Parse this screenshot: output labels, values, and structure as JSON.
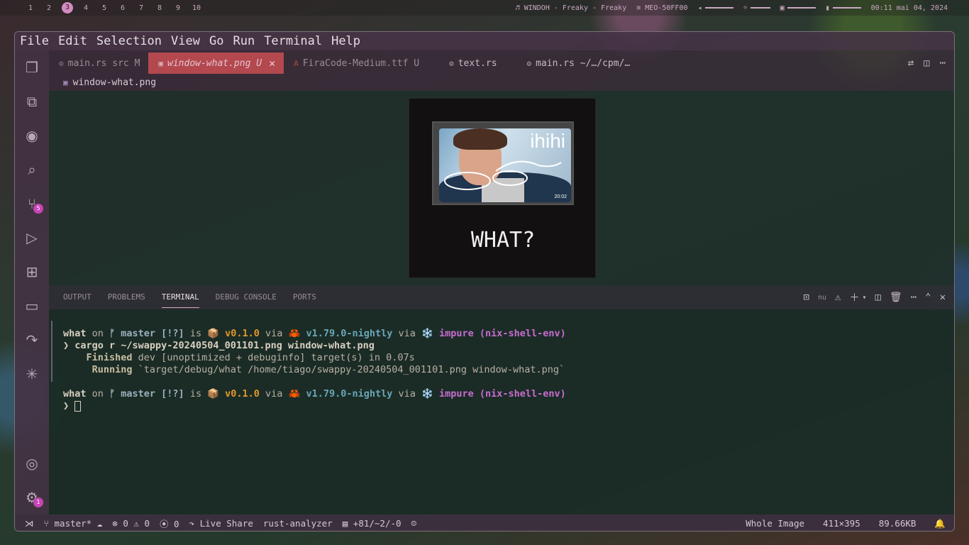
{
  "topbar": {
    "workspaces": [
      "1",
      "2",
      "3",
      "4",
      "5",
      "6",
      "7",
      "8",
      "9",
      "10"
    ],
    "active_workspace": "3",
    "now_playing": "♬ WINDOH - Freaky - Freaky",
    "wifi": "MEO-50FF00",
    "clock": "00:11 mai 04, 2024"
  },
  "menu": [
    "File",
    "Edit",
    "Selection",
    "View",
    "Go",
    "Run",
    "Terminal",
    "Help"
  ],
  "activity": {
    "source_control_badge": "5",
    "settings_badge": "1"
  },
  "tabs": [
    {
      "label": "main.rs",
      "detail": "src",
      "status": "M"
    },
    {
      "label": "window-what.png",
      "status": "U"
    },
    {
      "label": "FiraCode-Medium.ttf",
      "status": "U"
    },
    {
      "label": "text.rs"
    },
    {
      "label": "main.rs",
      "detail": "~/…/cpm/…"
    }
  ],
  "breadcrumb": "window-what.png",
  "preview": {
    "overlay_text": "ihihi",
    "timestamp": "20:02",
    "caption": "WHAT?"
  },
  "panel": {
    "tabs": [
      "OUTPUT",
      "PROBLEMS",
      "TERMINAL",
      "DEBUG CONSOLE",
      "PORTS"
    ],
    "active": "TERMINAL",
    "shell": "nu"
  },
  "terminal": {
    "prompt1": {
      "dir": "what",
      "on": " on ",
      "branch_icon": "ᚠ",
      "branch": " master [!?]",
      "is": " is ",
      "pkg_icon": "📦",
      "version": " v0.1.0",
      "via1": " via ",
      "crab": "🦀",
      "rust": " v1.79.0-nightly",
      "via2": " via ",
      "snow": "❄️",
      "nix": " impure (nix-shell-env)"
    },
    "cmd1": "❯ cargo r ~/swappy-20240504_001101.png window-what.png",
    "out1_label": "    Finished",
    "out1_text": " dev [unoptimized + debuginfo] target(s) in 0.07s",
    "out2_label": "     Running",
    "out2_text": " `target/debug/what /home/tiago/swappy-20240504_001101.png window-what.png`",
    "prompt2_arrow": "❯ "
  },
  "status": {
    "branch": "master*",
    "errors": "0",
    "warnings": "0",
    "ports": "0",
    "live_share": "Live Share",
    "analyzer": "rust-analyzer",
    "changes": "+81/~2/-0",
    "image_mode": "Whole Image",
    "dimensions": "411×395",
    "filesize": "89.66KB"
  }
}
